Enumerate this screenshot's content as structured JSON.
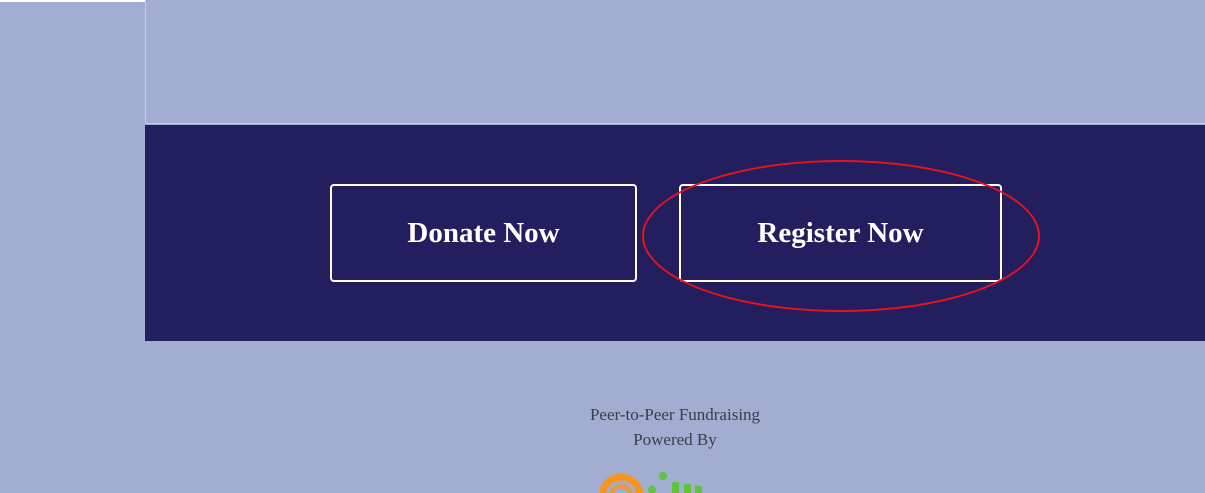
{
  "cta": {
    "donate_label": "Donate Now",
    "register_label": "Register Now"
  },
  "footer": {
    "line1": "Peer-to-Peer Fundraising",
    "line2": "Powered By"
  },
  "colors": {
    "page_background": "#a1aed1",
    "band_background": "#231f5f",
    "button_border": "#ffffff",
    "highlight_ring": "#e8121a",
    "logo_orange": "#f7941d",
    "logo_green": "#5ec43c"
  },
  "icons": {
    "footer_logo": "powered-by-logo"
  }
}
